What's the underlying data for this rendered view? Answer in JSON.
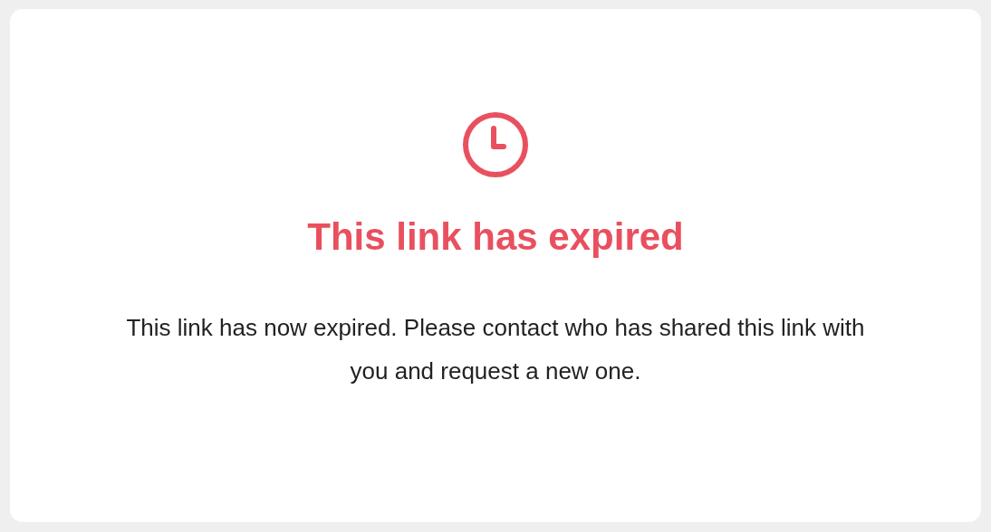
{
  "title": "This link has expired",
  "message": "This link has now expired. Please contact who has shared this link with you and request a new one."
}
